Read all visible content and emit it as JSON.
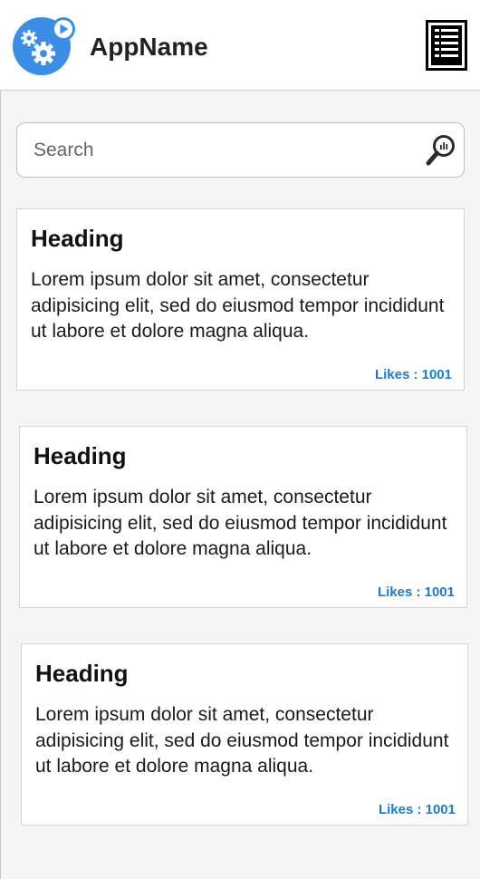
{
  "header": {
    "app_name": "AppName",
    "logo_icon": "gears-play-logo-icon",
    "menu_icon": "list-menu-icon"
  },
  "search": {
    "placeholder": "Search",
    "value": "",
    "icon": "magnifier-chart-icon"
  },
  "cards": [
    {
      "heading": "Heading",
      "body": "Lorem ipsum dolor sit amet, consectetur adipisicing elit, sed do eiusmod tempor incididunt ut labore et dolore magna aliqua.",
      "likes": "Likes : 1001"
    },
    {
      "heading": "Heading",
      "body": "Lorem ipsum dolor sit amet, consectetur adipisicing elit, sed do eiusmod tempor incididunt ut labore et dolore magna aliqua.",
      "likes": "Likes : 1001"
    },
    {
      "heading": "Heading",
      "body": "Lorem ipsum dolor sit amet, consectetur adipisicing elit, sed do eiusmod tempor incididunt ut labore et dolore magna aliqua.",
      "likes": "Likes : 1001"
    }
  ],
  "colors": {
    "brand_blue": "#3a8ee6",
    "likes_blue": "#1a7bd4",
    "background": "#f5f5f5"
  }
}
